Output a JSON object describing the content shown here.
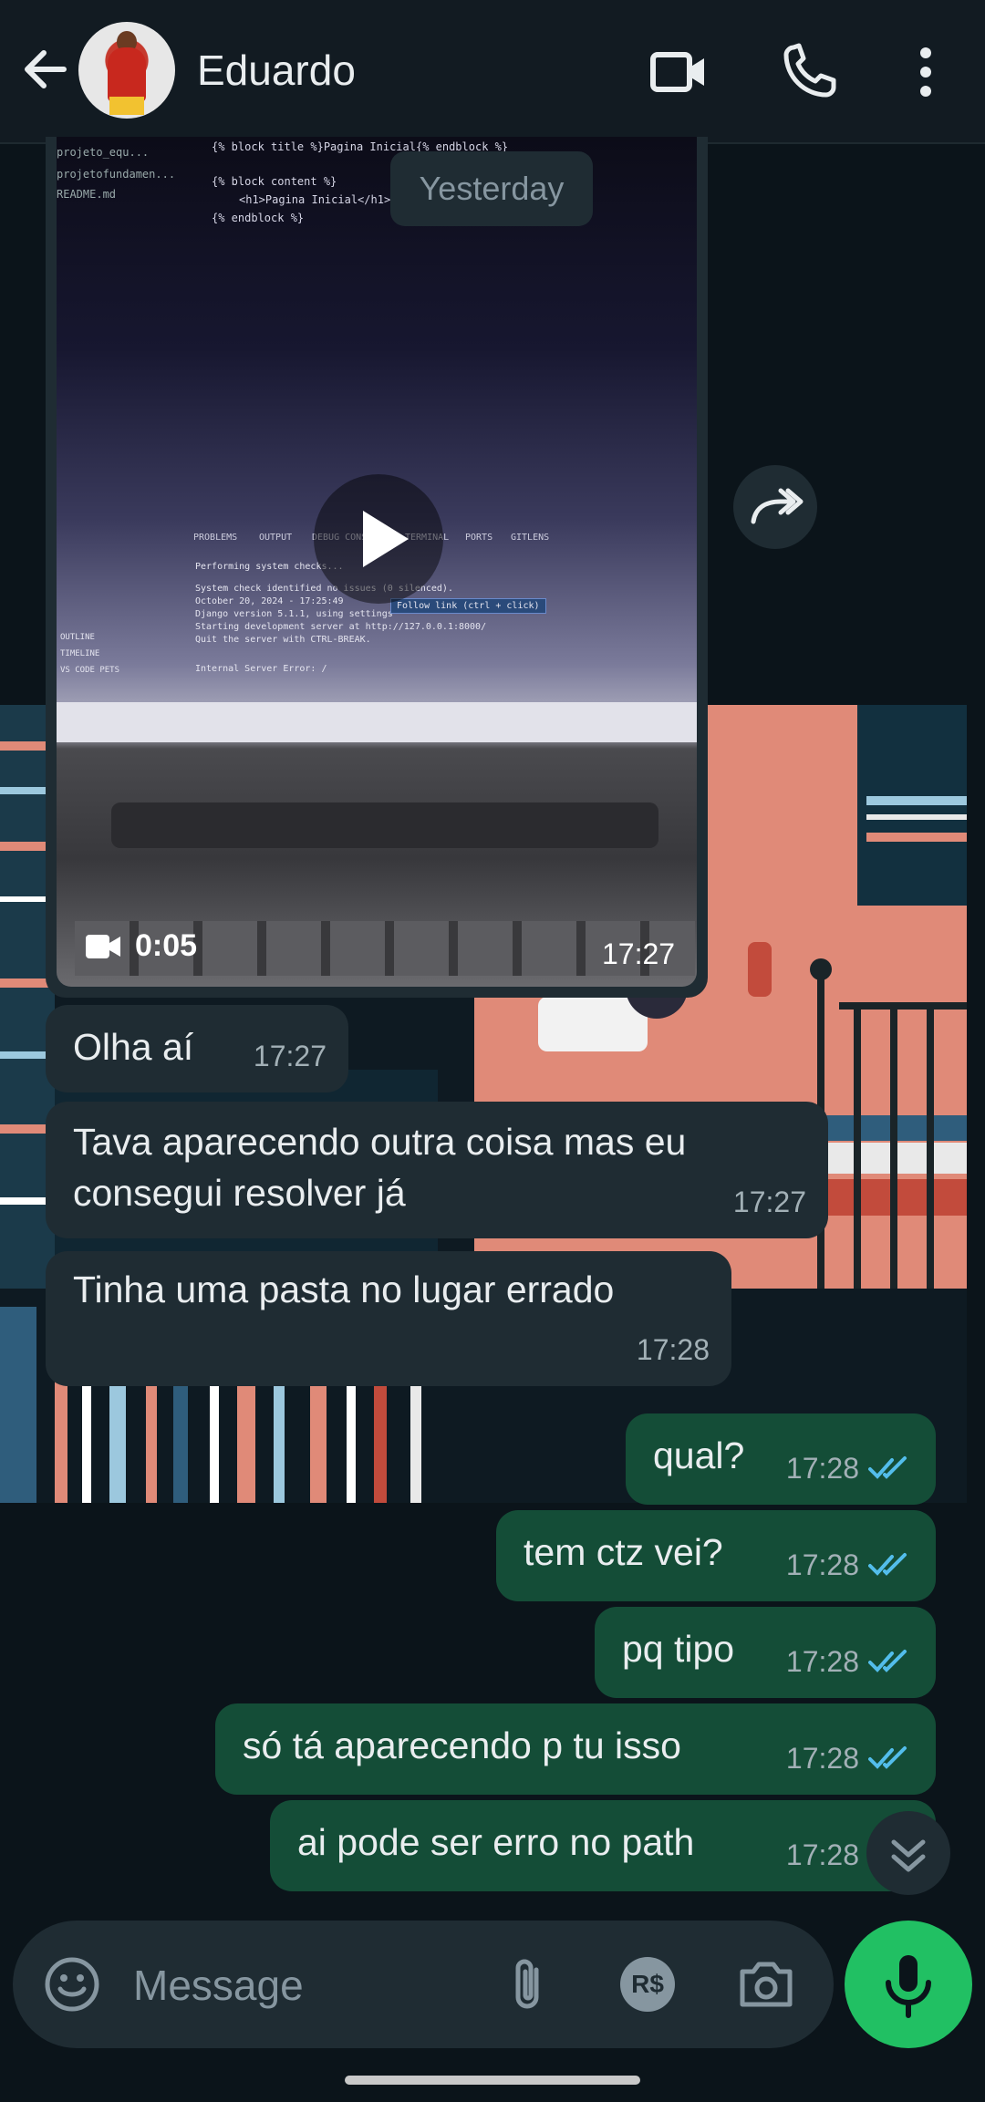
{
  "header": {
    "contact_name": "Eduardo",
    "icons": [
      "back-arrow-icon",
      "video-call-icon",
      "voice-call-icon",
      "more-options-icon"
    ]
  },
  "chat": {
    "day_divider": "Yesterday",
    "video_message": {
      "duration": "0:05",
      "time": "17:27",
      "code_lines": [
        "{% block title %}Pagina Inicial{% endblock %}",
        "{% block content %}",
        "<h1>Pagina Inicial</h1>",
        "{% endblock %}"
      ],
      "sidebar_files": [
        "projeto_equ...",
        "projetofundamen...",
        "README.md"
      ],
      "panel_tabs": [
        "PROBLEMS",
        "OUTPUT",
        "DEBUG CONSOLE",
        "TERMINAL",
        "PORTS",
        "GITLENS"
      ],
      "terminal_lines": [
        "Performing system checks...",
        "System check identified no issues (0 silenced).",
        "October 20, 2024 - 17:25:49",
        "Django version 5.1.1, using settings",
        "Starting development server at http://127.0.0.1:8000/",
        "Quit the server with CTRL-BREAK.",
        "Internal Server Error: /"
      ],
      "follow_link_tip": "Follow link (ctrl + click)",
      "outline_items": [
        "OUTLINE",
        "TIMELINE",
        "VS CODE PETS"
      ]
    },
    "messages": [
      {
        "dir": "in",
        "text": "Olha aí",
        "time": "17:27"
      },
      {
        "dir": "in",
        "text": "Tava aparecendo outra coisa mas eu consegui resolver já",
        "line1": "Tava aparecendo outra coisa mas eu",
        "line2": "consegui resolver já",
        "time": "17:27"
      },
      {
        "dir": "in",
        "text": "Tinha uma pasta no lugar errado",
        "time": "17:28"
      },
      {
        "dir": "out",
        "text": "qual?",
        "time": "17:28",
        "status": "read"
      },
      {
        "dir": "out",
        "text": "tem ctz vei?",
        "time": "17:28",
        "status": "read"
      },
      {
        "dir": "out",
        "text": "pq tipo",
        "time": "17:28",
        "status": "read"
      },
      {
        "dir": "out",
        "text": "só tá aparecendo p tu isso",
        "time": "17:28",
        "status": "read"
      },
      {
        "dir": "out",
        "text": "ai pode ser erro no path",
        "time": "17:28",
        "status": "read"
      }
    ]
  },
  "composer": {
    "placeholder": "Message",
    "icons": [
      "emoji-icon",
      "attach-icon",
      "payment-icon",
      "camera-icon",
      "mic-icon"
    ],
    "payment_label": "R$"
  },
  "colors": {
    "header_bg": "#121b22",
    "incoming_bubble": "#1f2c33",
    "outgoing_bubble": "#144d37",
    "read_tick": "#53bdeb",
    "mic_button": "#21c063"
  }
}
